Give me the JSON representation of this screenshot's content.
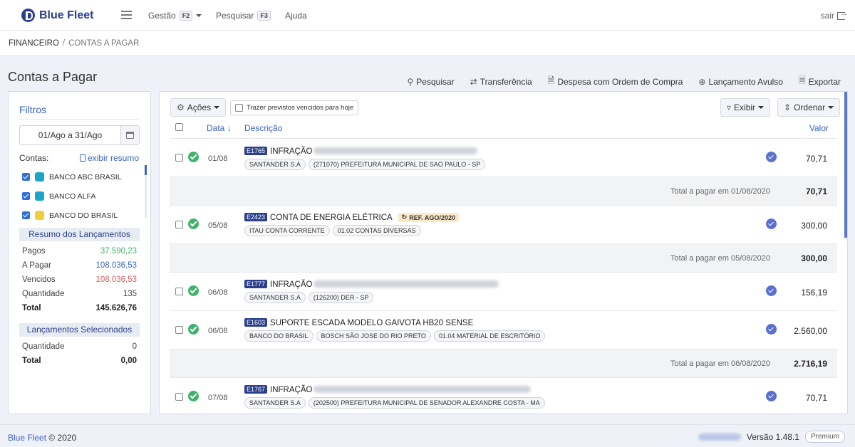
{
  "app": {
    "name": "Blue Fleet"
  },
  "nav": {
    "gestao": {
      "label": "Gestão",
      "key": "F2"
    },
    "pesquisar": {
      "label": "Pesquisar",
      "key": "F3"
    },
    "ajuda": {
      "label": "Ajuda"
    },
    "logout": {
      "label": "sair"
    }
  },
  "breadcrumb": {
    "root": "FINANCEIRO",
    "sep": "/",
    "current": "CONTAS A PAGAR"
  },
  "page": {
    "title": "Contas a Pagar"
  },
  "actions": {
    "pesquisar": "Pesquisar",
    "transferencia": "Transferência",
    "despesa": "Despesa com Ordem de Compra",
    "lancamento": "Lançamento Avulso",
    "exportar": "Exportar"
  },
  "filters": {
    "title": "Filtros",
    "date_range": "01/Ago a 31/Ago",
    "contas_label": "Contas:",
    "resumo_link": "exibir resumo",
    "banks": [
      {
        "name": "BANCO ABC BRASIL",
        "checked": true,
        "color": "#1ba6c9"
      },
      {
        "name": "BANCO ALFA",
        "checked": true,
        "color": "#1ba6c9"
      },
      {
        "name": "BANCO DO BRASIL",
        "checked": true,
        "color": "#f2cf3a"
      }
    ],
    "resumo": {
      "title": "Resumo dos Lançamentos",
      "pagos": {
        "label": "Pagos",
        "value": "37.590,23",
        "color": "#3fb36b"
      },
      "a_pagar": {
        "label": "A Pagar",
        "value": "108.036,53",
        "color": "#3b62c0"
      },
      "vencidos": {
        "label": "Vencidos",
        "value": "108.036,53",
        "color": "#e05a5a"
      },
      "quantidade": {
        "label": "Quantidade",
        "value": "135"
      },
      "total": {
        "label": "Total",
        "value": "145.626,76"
      }
    },
    "selecionados": {
      "title": "Lançamentos Selecionados",
      "quantidade": {
        "label": "Quantidade",
        "value": "0"
      },
      "total": {
        "label": "Total",
        "value": "0,00"
      }
    }
  },
  "toolbar": {
    "acoes": "Ações",
    "previstos": "Trazer previstos vencidos para hoje",
    "exibir": "Exibir",
    "ordenar": "Ordenar"
  },
  "table": {
    "headers": {
      "data": "Data",
      "descricao": "Descrição",
      "valor": "Valor"
    },
    "rows": [
      {
        "date": "01/08",
        "code": "E1765",
        "desc": "INFRAÇÃO",
        "tags": [
          "SANTANDER S.A",
          "(271070) PREFEITURA MUNICIPAL DE SAO PAULO - SP"
        ],
        "value": "70,71"
      },
      {
        "date": "05/08",
        "code": "E2423",
        "desc": "CONTA DE ENERGIA ELÉTRICA",
        "ref": "REF. AGO/2020",
        "tags": [
          "ITAU CONTA CORRENTE",
          "01.02 CONTAS DIVERSAS"
        ],
        "value": "300,00"
      },
      {
        "date": "06/08",
        "code": "E1777",
        "desc": "INFRAÇÃO",
        "tags": [
          "SANTANDER S.A",
          "(126200) DER - SP"
        ],
        "value": "156,19"
      },
      {
        "date": "06/08",
        "code": "E1603",
        "desc": "SUPORTE ESCADA MODELO GAIVOTA HB20 SENSE",
        "tags": [
          "BANCO DO BRASIL",
          "BOSCH SÃO JOSE DO RIO PRETO",
          "01.04 MATERIAL DE ESCRITÓRIO"
        ],
        "value": "2.560,00"
      },
      {
        "date": "07/08",
        "code": "E1767",
        "desc": "INFRAÇÃO",
        "tags": [
          "SANTANDER S.A",
          "(202500) PREFEITURA MUNICIPAL DE SENADOR ALEXANDRE COSTA - MA"
        ],
        "value": "70,71"
      }
    ],
    "subtotals": [
      {
        "label": "Total a pagar em 01/08/2020",
        "value": "70,71"
      },
      {
        "label": "Total a pagar em 05/08/2020",
        "value": "300,00"
      },
      {
        "label": "Total a pagar em 06/08/2020",
        "value": "2.716,19"
      }
    ]
  },
  "footer": {
    "app": "Blue Fleet",
    "copyright": "© 2020",
    "version": "Versão 1.48.1",
    "plan": "Premium"
  }
}
